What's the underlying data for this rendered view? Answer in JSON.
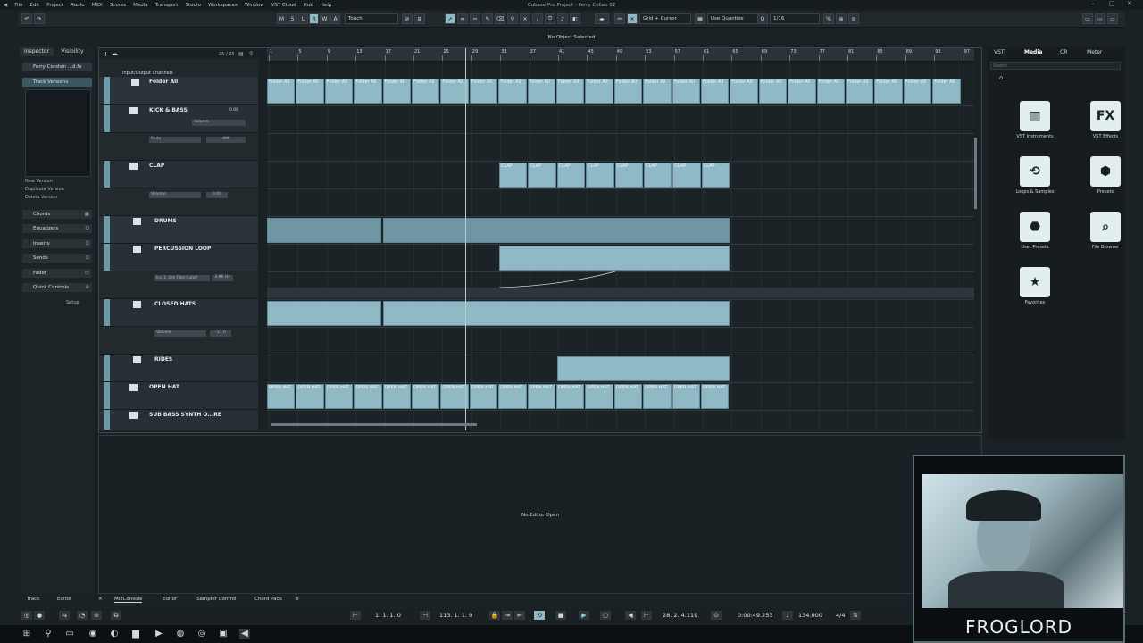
{
  "app": {
    "title": "Cubase Pro Project - Ferry Collab 02"
  },
  "menu": [
    "File",
    "Edit",
    "Project",
    "Audio",
    "MIDI",
    "Scores",
    "Media",
    "Transport",
    "Studio",
    "Workspaces",
    "Window",
    "VST Cloud",
    "Hub",
    "Help"
  ],
  "toolbar": {
    "m": "M",
    "s": "S",
    "l": "L",
    "r": "R",
    "w": "W",
    "a": "A",
    "automation_mode": "Touch",
    "snap_mode": "Grid + Cursor",
    "quantize_mode": "Use Quantize",
    "quantize_value": "1/16"
  },
  "status": {
    "selection": "No Object Selected"
  },
  "inspector": {
    "tabs": [
      "Inspector",
      "Visibility"
    ],
    "track_name": "Ferry Corsten ...d.fx",
    "track_versions": "Track Versions",
    "versions": [
      "New Version",
      "Duplicate Version",
      "Delete Version"
    ],
    "sections": [
      "Chords",
      "Equalizers",
      "Inserts",
      "Sends",
      "Fader",
      "Quick Controls"
    ],
    "setup": "Setup"
  },
  "project": {
    "count": "25 / 25",
    "io": "Input/Output Channels",
    "tracks": [
      {
        "name": "Folder All"
      },
      {
        "name": "KICK & BASS"
      },
      {
        "name": "CLAP"
      },
      {
        "name": "DRUMS"
      },
      {
        "name": "PERCUSSION LOOP"
      },
      {
        "name": "CLOSED HATS"
      },
      {
        "name": "RIDES"
      },
      {
        "name": "OPEN HAT"
      },
      {
        "name": "SUB BASS SYNTH O...RE"
      }
    ],
    "lanes": {
      "mute": "Mute",
      "mute_val": "Off",
      "volume": "Volume",
      "volume_val": "0.00",
      "cutoff": "Ins. 1: Ulm Filter-Cutoff",
      "cutoff_val": "3.96 Hz",
      "hats_vol": "Volume",
      "hats_vol_val": "-11.0",
      "kick_vol": "Volume",
      "kick_vol_val": "0.00"
    },
    "ruler": [
      "1",
      "5",
      "9",
      "13",
      "17",
      "21",
      "25",
      "29",
      "33",
      "37",
      "41",
      "45",
      "49",
      "53",
      "57",
      "61",
      "65",
      "69",
      "73",
      "77",
      "81",
      "85",
      "89",
      "93",
      "97"
    ],
    "event_labels": {
      "folder": "Folder All",
      "clap": "CLAP",
      "openhat": "OPEN HAT"
    }
  },
  "media": {
    "tabs": [
      "VSTi",
      "Media",
      "CR",
      "Meter"
    ],
    "search_placeholder": "Search",
    "items": [
      {
        "label": "VST Instruments",
        "icon": "piano-icon"
      },
      {
        "label": "VST Effects",
        "icon": "fx-icon"
      },
      {
        "label": "Loops & Samples",
        "icon": "loop-icon"
      },
      {
        "label": "Presets",
        "icon": "presets-icon"
      },
      {
        "label": "User Presets",
        "icon": "user-presets-icon"
      },
      {
        "label": "File Browser",
        "icon": "file-browser-icon"
      },
      {
        "label": "Favorites",
        "icon": "star-icon"
      }
    ],
    "fx_text": "FX"
  },
  "lower": {
    "message": "No Editor Open"
  },
  "bottom_tabs": [
    "Track",
    "Editor",
    "MixConsole",
    "Editor",
    "Sampler Control",
    "Chord Pads"
  ],
  "transport": {
    "left_locator": "1. 1. 1. 0",
    "right_locator": "113. 1. 1. 0",
    "position": "28. 2. 4.119",
    "time": "0:00:49.253",
    "tempo": "134.000",
    "signature": "4/4"
  },
  "webcam": {
    "overlay": "FROGLORD"
  },
  "colors": {
    "accent": "#8fb9c4",
    "bg": "#1b2226"
  }
}
